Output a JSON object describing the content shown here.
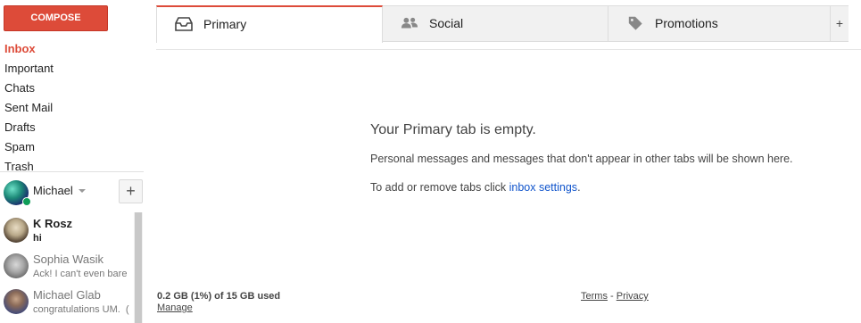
{
  "compose_label": "COMPOSE",
  "nav": [
    {
      "label": "Inbox",
      "active": true
    },
    {
      "label": "Important"
    },
    {
      "label": "Chats"
    },
    {
      "label": "Sent Mail"
    },
    {
      "label": "Drafts"
    },
    {
      "label": "Spam"
    },
    {
      "label": "Trash"
    }
  ],
  "chat": {
    "me_name": "Michael",
    "add_label": "+",
    "contacts": [
      {
        "name": "K Rosz",
        "message": "hi",
        "unread": true
      },
      {
        "name": "Sophia Wasik",
        "message": "Ack! I can't even bare"
      },
      {
        "name": "Michael Glab",
        "message": "congratulations UM.  ("
      }
    ]
  },
  "tabs": [
    {
      "label": "Primary",
      "icon": "inbox-icon",
      "active": true
    },
    {
      "label": "Social",
      "icon": "people-icon"
    },
    {
      "label": "Promotions",
      "icon": "tag-icon"
    }
  ],
  "tab_add_label": "+",
  "empty": {
    "title": "Your Primary tab is empty.",
    "description": "Personal messages and messages that don't appear in other tabs will be shown here.",
    "hint_prefix": "To add or remove tabs click ",
    "hint_link": "inbox settings",
    "hint_suffix": "."
  },
  "footer": {
    "storage": "0.2 GB (1%) of 15 GB used",
    "manage": "Manage",
    "terms": "Terms",
    "separator": " - ",
    "privacy": "Privacy"
  },
  "colors": {
    "accent_red": "#dd4b39",
    "link_blue": "#1155cc",
    "online_green": "#0f9d58"
  }
}
